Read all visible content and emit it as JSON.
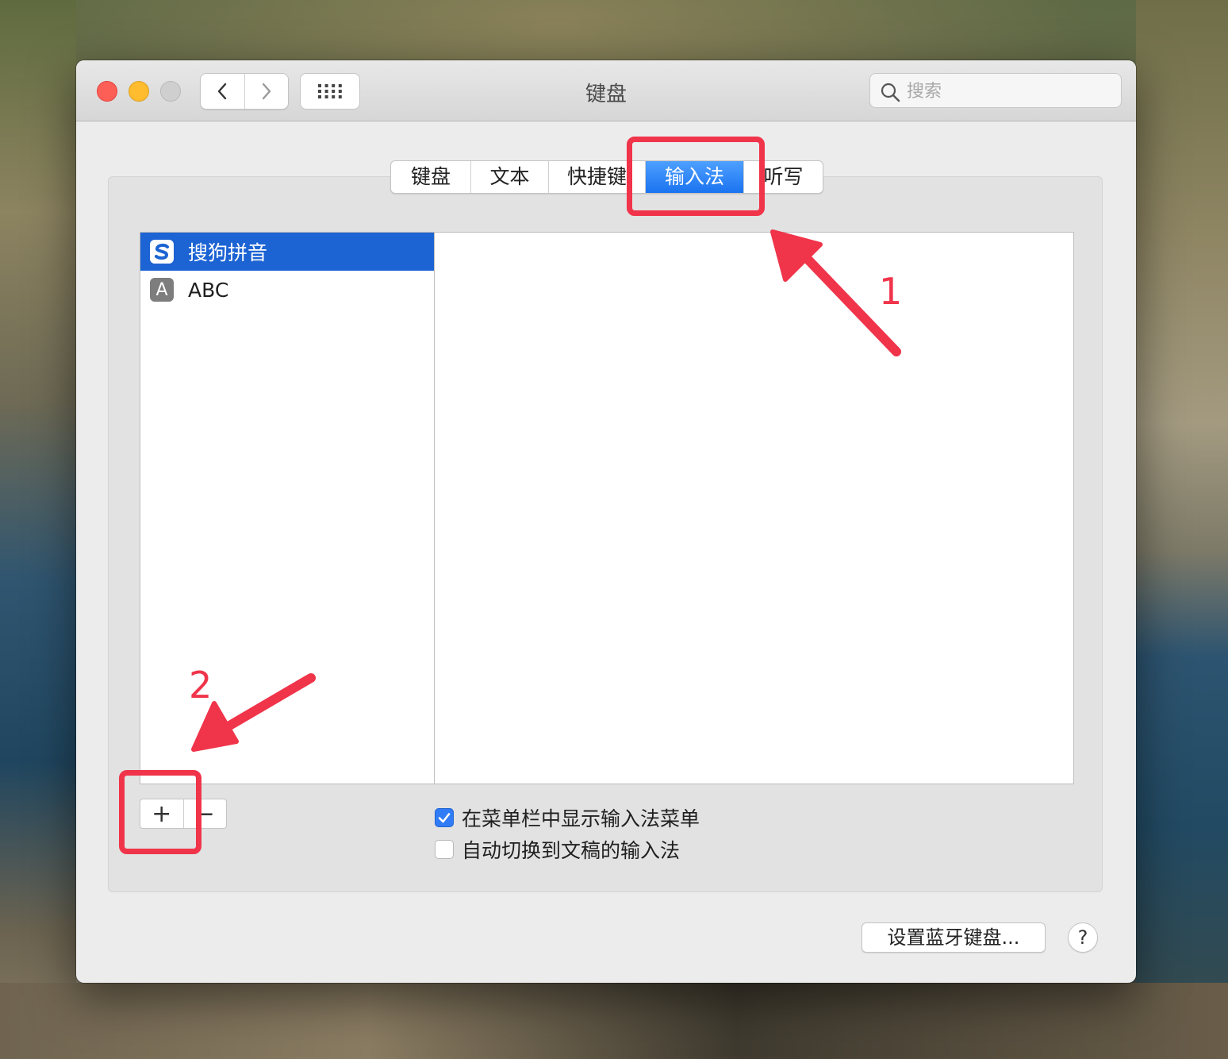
{
  "window": {
    "title": "键盘"
  },
  "toolbar": {
    "back_icon": "chevron-left-icon",
    "forward_icon": "chevron-right-icon",
    "grid_icon": "grid-icon"
  },
  "search": {
    "placeholder": "搜索"
  },
  "tabs": [
    {
      "label": "键盘",
      "active": false
    },
    {
      "label": "文本",
      "active": false
    },
    {
      "label": "快捷键",
      "active": false
    },
    {
      "label": "输入法",
      "active": true
    },
    {
      "label": "听写",
      "active": false
    }
  ],
  "input_sources": [
    {
      "label": "搜狗拼音",
      "icon": "sogou-icon",
      "selected": true
    },
    {
      "label": "ABC",
      "icon": "abc-icon",
      "icon_text": "A",
      "selected": false
    }
  ],
  "list_controls": {
    "add": "+",
    "remove": "−"
  },
  "options": [
    {
      "label": "在菜单栏中显示输入法菜单",
      "checked": true
    },
    {
      "label": "自动切换到文稿的输入法",
      "checked": false
    }
  ],
  "footer": {
    "bluetooth_button": "设置蓝牙键盘...",
    "help_button": "?"
  },
  "annotations": {
    "step1": "1",
    "step2": "2",
    "color": "#f0344a"
  },
  "colors": {
    "accent": "#1c63d3",
    "tab_active": "#2f7cf6",
    "close": "#fd5f57",
    "minimize": "#febc2e"
  }
}
